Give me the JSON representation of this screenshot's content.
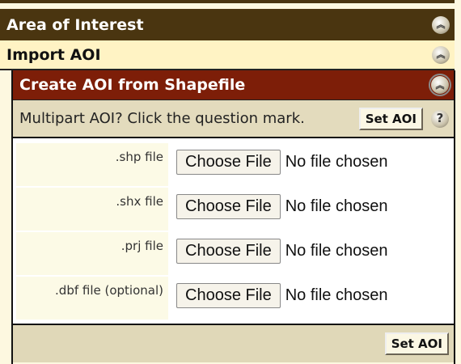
{
  "sections": {
    "area_of_interest": "Area of Interest",
    "import_aoi": "Import AOI",
    "create_from_shapefile": "Create AOI from Shapefile"
  },
  "multipart": {
    "text": "Multipart AOI? Click the question mark.",
    "set_aoi": "Set AOI",
    "help": "?"
  },
  "icons": {
    "collapse": "chevron-double-up-icon",
    "help": "question-mark-icon"
  },
  "files": [
    {
      "label": ".shp file",
      "button": "Choose File",
      "status": "No file chosen"
    },
    {
      "label": ".shx file",
      "button": "Choose File",
      "status": "No file chosen"
    },
    {
      "label": ".prj file",
      "button": "Choose File",
      "status": "No file chosen"
    },
    {
      "label": ".dbf file (optional)",
      "button": "Choose File",
      "status": "No file chosen"
    }
  ],
  "footer": {
    "set_aoi": "Set AOI"
  },
  "colors": {
    "aoi_header": "#4a3510",
    "import_header": "#fff3c4",
    "create_header": "#7d1e08",
    "toolbar": "#e3dbbd"
  }
}
